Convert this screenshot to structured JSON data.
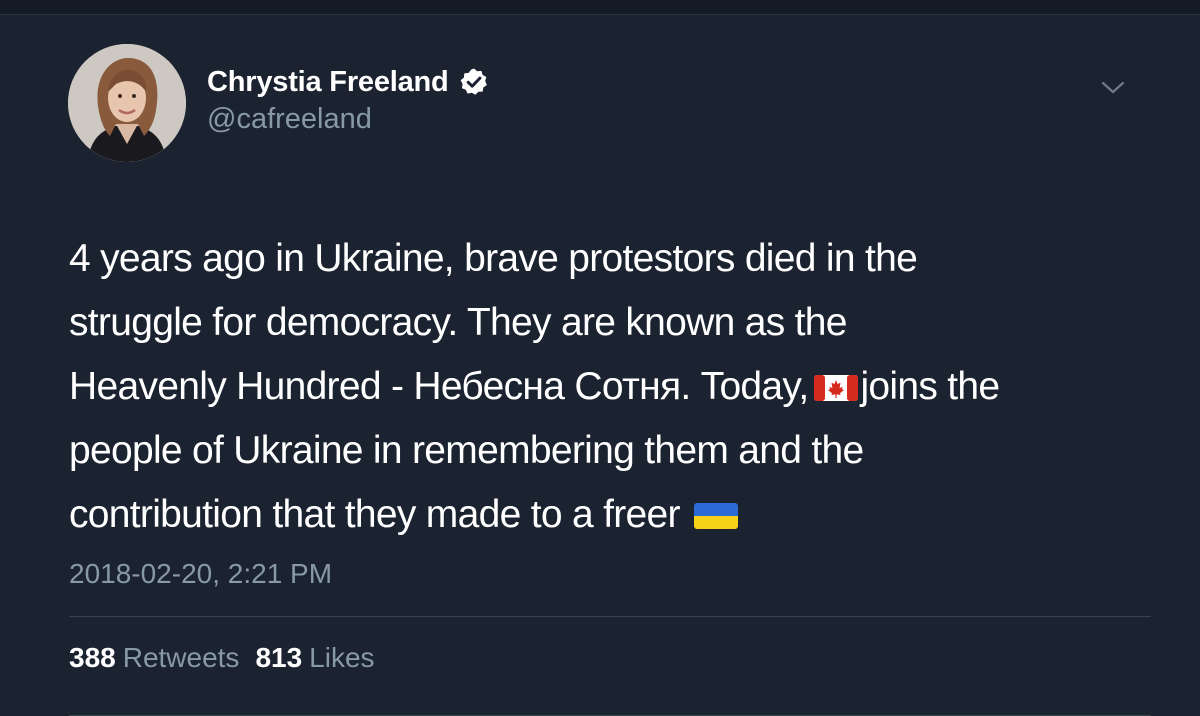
{
  "tweet": {
    "author": {
      "display_name": "Chrystia Freeland",
      "handle": "@cafreeland",
      "verified": true
    },
    "text_lines": [
      "4 years ago in Ukraine, brave protestors died in the",
      "struggle for democracy. They are known as the",
      "Heavenly Hundred - Небесна Сотня. Today,",
      "joins the",
      "people of Ukraine in remembering them and the",
      "contribution that they made to a freer"
    ],
    "emoji": {
      "canada_flag": "canada-flag-emoji",
      "ukraine_flag": "ukraine-flag-emoji"
    },
    "timestamp": "2018-02-20, 2:21 PM",
    "stats": {
      "retweets_count": "388",
      "retweets_label": "Retweets",
      "likes_count": "813",
      "likes_label": "Likes"
    }
  },
  "colors": {
    "background": "#1b2230",
    "text_primary": "#ffffff",
    "text_secondary": "#8899a6",
    "divider": "#38444d"
  },
  "icons": {
    "verified": "verified-badge-icon",
    "menu": "chevron-down-icon"
  }
}
